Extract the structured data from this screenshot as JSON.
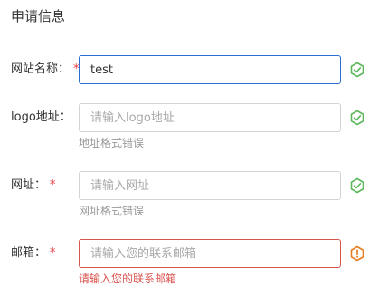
{
  "form": {
    "title": "申请信息",
    "colors": {
      "success": "#5cb85c",
      "warning": "#e67e22",
      "error": "#d9534f",
      "focus": "#2a6dd1",
      "required": "#e4393c"
    },
    "fields": [
      {
        "label": "网站名称：",
        "required": "*",
        "value": "test",
        "placeholder": "",
        "hint": "",
        "status_icon": "check-circle-icon"
      },
      {
        "label": "logo地址：",
        "required": "",
        "value": "",
        "placeholder": "请输入logo地址",
        "hint": "地址格式错误",
        "status_icon": "check-circle-icon"
      },
      {
        "label": "网址：",
        "required": "*",
        "value": "",
        "placeholder": "请输入网址",
        "hint": "网址格式错误",
        "status_icon": "check-circle-icon"
      },
      {
        "label": "邮箱：",
        "required": "*",
        "value": "",
        "placeholder": "请输入您的联系邮箱",
        "hint": "请输入您的联系邮箱",
        "status_icon": "warning-circle-icon"
      }
    ]
  }
}
